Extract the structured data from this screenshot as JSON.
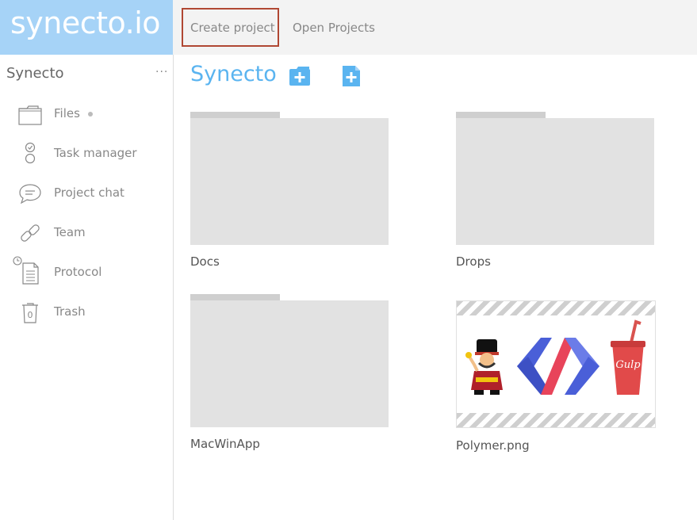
{
  "brand": {
    "text": "synecto.io"
  },
  "topbar": {
    "create_project": "Create project",
    "open_projects": "Open Projects"
  },
  "sidebar": {
    "project_name": "Synecto",
    "more": "···",
    "items": [
      {
        "label": "Files",
        "icon": "folder-icon",
        "has_dot": true
      },
      {
        "label": "Task manager",
        "icon": "task-icon"
      },
      {
        "label": "Project chat",
        "icon": "chat-bubble-icon"
      },
      {
        "label": "Team",
        "icon": "link-icon"
      },
      {
        "label": "Protocol",
        "icon": "document-icon"
      },
      {
        "label": "Trash",
        "icon": "trash-icon",
        "badge": "0"
      }
    ]
  },
  "main": {
    "title": "Synecto",
    "tiles": [
      {
        "type": "folder",
        "name": "Docs"
      },
      {
        "type": "folder",
        "name": "Drops"
      },
      {
        "type": "folder",
        "name": "MacWinApp"
      },
      {
        "type": "image",
        "name": "Polymer.png",
        "image_text": "Gulp"
      }
    ]
  },
  "colors": {
    "brand_bg": "#a6d3f7",
    "accent_blue": "#5ab4f0",
    "create_border": "#b04733",
    "folder_gray": "#e2e2e2"
  }
}
